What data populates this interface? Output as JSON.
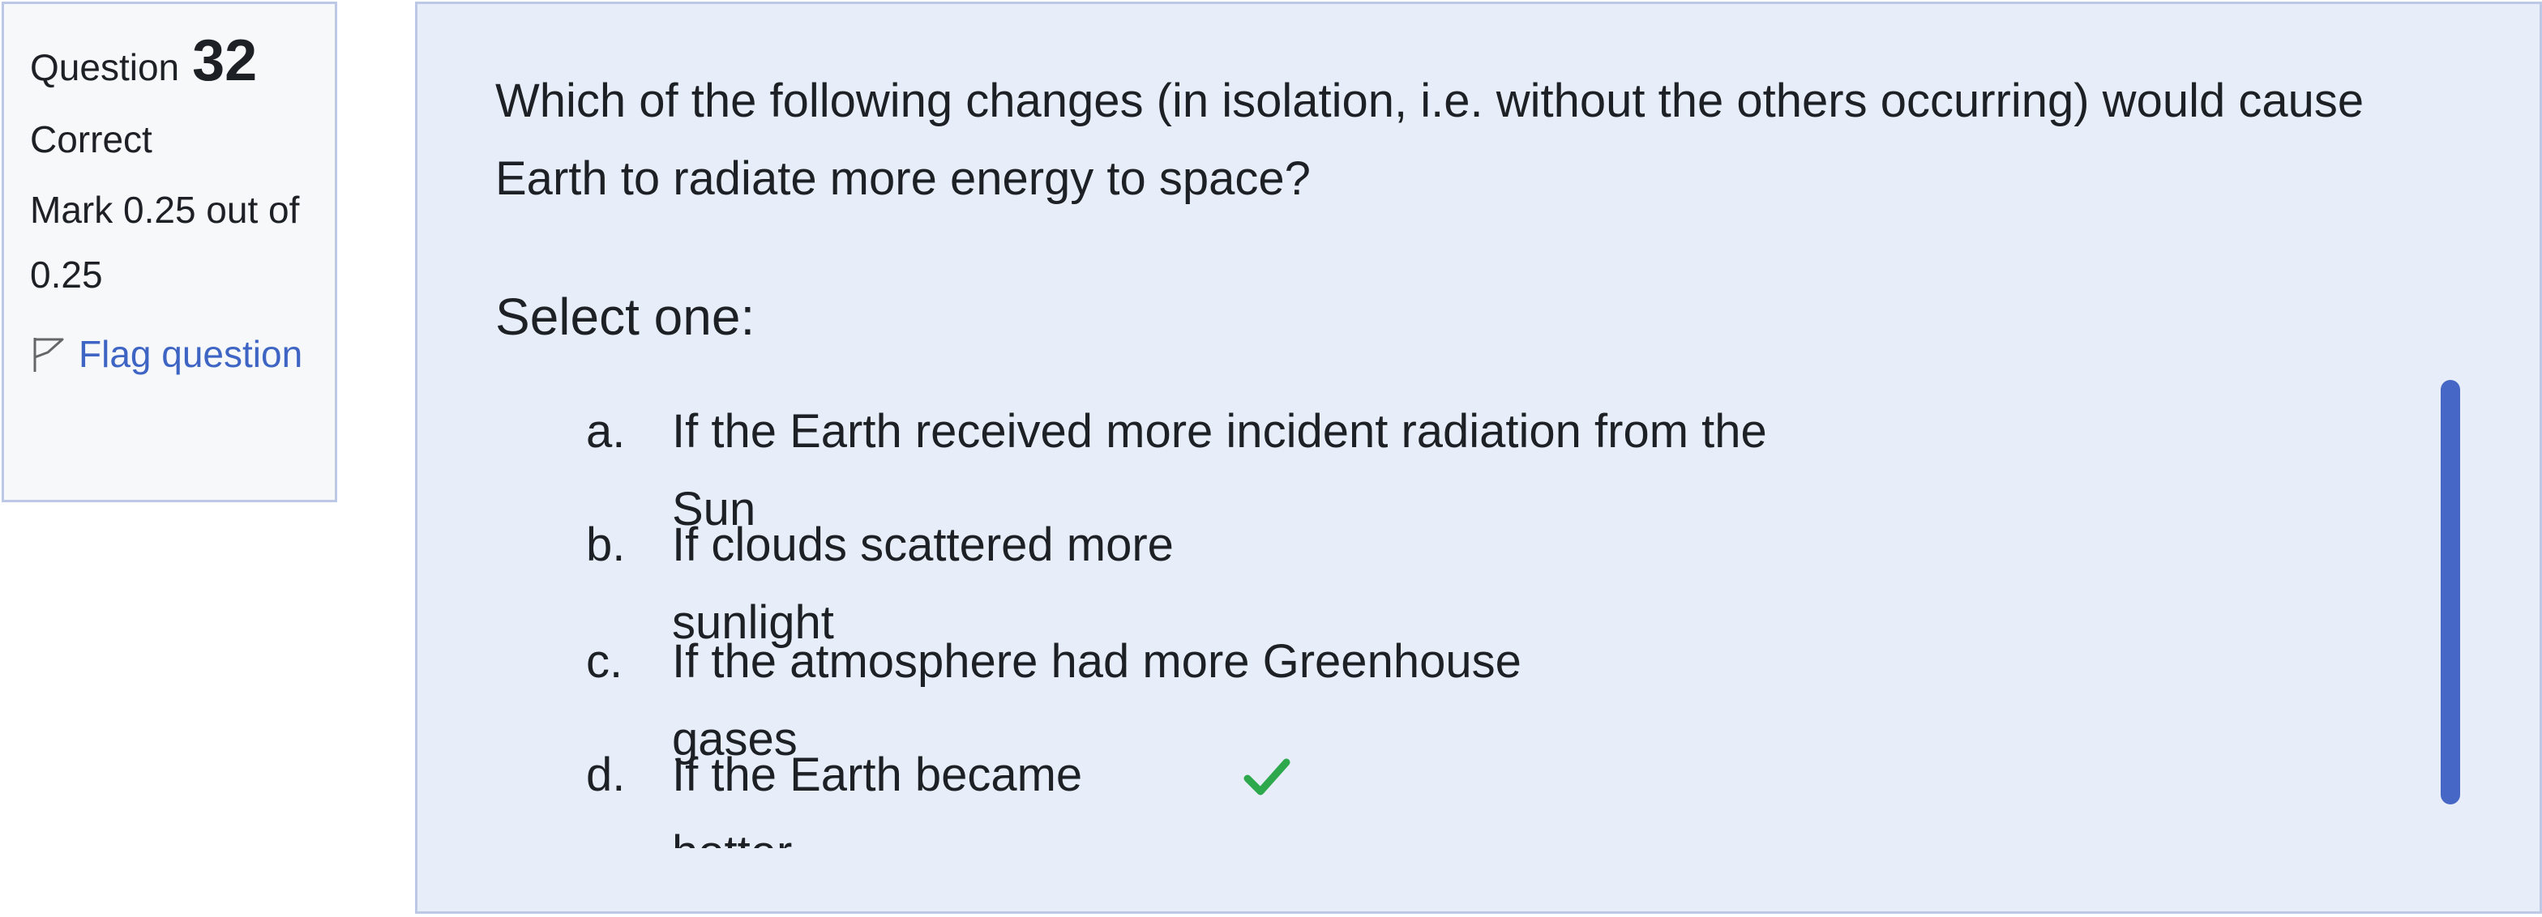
{
  "info": {
    "question_label": "Question",
    "question_number": "32",
    "state": "Correct",
    "grade": "Mark 0.25 out of 0.25",
    "flag_label": "Flag question",
    "flag_icon": "flag-icon"
  },
  "question": {
    "text": "Which of the following changes (in isolation, i.e. without the others occurring) would cause Earth to radiate more energy to space?",
    "prompt": "Select one:",
    "options": [
      {
        "letter": "a.",
        "text": "If the Earth received more incident radiation from the Sun"
      },
      {
        "letter": "b.",
        "text": "If clouds scattered more sunlight"
      },
      {
        "letter": "c.",
        "text": "If the atmosphere had more Greenhouse gases"
      },
      {
        "letter": "d.",
        "text": "If the Earth became hotter",
        "correct": true,
        "icon": "checkmark-icon"
      }
    ]
  },
  "colors": {
    "accent": "#3f65c4",
    "check": "#2ea84c",
    "panel": "#e8eef9",
    "border": "#bcc8e6"
  }
}
